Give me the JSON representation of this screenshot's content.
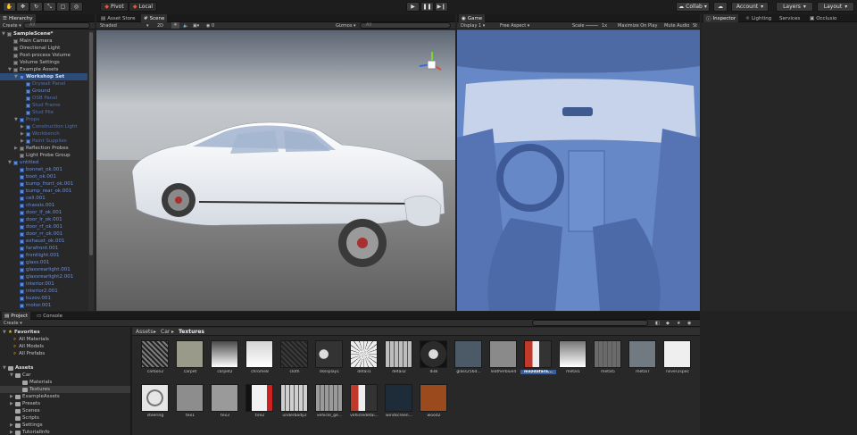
{
  "toolbar": {
    "pivot": "Pivot",
    "local": "Local",
    "collab": "Collab",
    "account": "Account",
    "layers": "Layers",
    "layout": "Layout"
  },
  "hierarchy": {
    "tab": "Hierarchy",
    "create": "Create",
    "search_placeholder": "All",
    "items": [
      {
        "label": "SampleScene*",
        "indent": 0,
        "style": "scene",
        "arrow": "▼"
      },
      {
        "label": "Main Camera",
        "indent": 1,
        "style": "normal"
      },
      {
        "label": "Directional Light",
        "indent": 1,
        "style": "normal"
      },
      {
        "label": "Post-process Volume",
        "indent": 1,
        "style": "normal"
      },
      {
        "label": "Volume Settings",
        "indent": 1,
        "style": "normal"
      },
      {
        "label": "Example Assets",
        "indent": 1,
        "style": "normal",
        "arrow": "▼"
      },
      {
        "label": "Workshop Set",
        "indent": 2,
        "style": "selected",
        "arrow": "▼"
      },
      {
        "label": "Drywall Panel",
        "indent": 3,
        "style": "dim"
      },
      {
        "label": "Ground",
        "indent": 3,
        "style": "blue"
      },
      {
        "label": "OSB Panel",
        "indent": 3,
        "style": "dim"
      },
      {
        "label": "Stud Frame",
        "indent": 3,
        "style": "dim"
      },
      {
        "label": "Stud Pile",
        "indent": 3,
        "style": "dim"
      },
      {
        "label": "Props",
        "indent": 2,
        "style": "dim",
        "arrow": "▼"
      },
      {
        "label": "Construction Light",
        "indent": 3,
        "style": "dim",
        "arrow": "▶"
      },
      {
        "label": "Workbench",
        "indent": 3,
        "style": "dim",
        "arrow": "▶"
      },
      {
        "label": "Paint Supplies",
        "indent": 3,
        "style": "dim",
        "arrow": "▶"
      },
      {
        "label": "Reflection Probes",
        "indent": 2,
        "style": "normal",
        "arrow": "▶"
      },
      {
        "label": "Light Probe Group",
        "indent": 2,
        "style": "normal"
      },
      {
        "label": "untitled",
        "indent": 1,
        "style": "blue",
        "arrow": "▼"
      },
      {
        "label": "bonnet_ok.001",
        "indent": 2,
        "style": "blue"
      },
      {
        "label": "boot_ok.001",
        "indent": 2,
        "style": "blue"
      },
      {
        "label": "bump_front_ok.001",
        "indent": 2,
        "style": "blue"
      },
      {
        "label": "bump_rear_ok.001",
        "indent": 2,
        "style": "blue"
      },
      {
        "label": "cell.001",
        "indent": 2,
        "style": "blue"
      },
      {
        "label": "chassis.001",
        "indent": 2,
        "style": "blue"
      },
      {
        "label": "door_lf_ok.001",
        "indent": 2,
        "style": "blue"
      },
      {
        "label": "door_lr_ok.001",
        "indent": 2,
        "style": "blue"
      },
      {
        "label": "door_rf_ok.001",
        "indent": 2,
        "style": "blue"
      },
      {
        "label": "door_rr_ok.001",
        "indent": 2,
        "style": "blue"
      },
      {
        "label": "exhaust_ok.001",
        "indent": 2,
        "style": "blue"
      },
      {
        "label": "farafront.001",
        "indent": 2,
        "style": "blue"
      },
      {
        "label": "frontlight.001",
        "indent": 2,
        "style": "blue"
      },
      {
        "label": "glass.001",
        "indent": 2,
        "style": "blue"
      },
      {
        "label": "glassrearlight.001",
        "indent": 2,
        "style": "blue"
      },
      {
        "label": "glassrearlight2.001",
        "indent": 2,
        "style": "blue"
      },
      {
        "label": "interior.001",
        "indent": 2,
        "style": "blue"
      },
      {
        "label": "interior2.001",
        "indent": 2,
        "style": "blue"
      },
      {
        "label": "kuzov.001",
        "indent": 2,
        "style": "blue"
      },
      {
        "label": "motor.001",
        "indent": 2,
        "style": "blue"
      }
    ]
  },
  "scene": {
    "tab_asset_store": "Asset Store",
    "tab_scene": "Scene",
    "shading": "Shaded",
    "mode_2d": "2D",
    "gizmos": "Gizmos",
    "search_placeholder": "All"
  },
  "game": {
    "tab": "Game",
    "display": "Display 1",
    "aspect": "Free Aspect",
    "scale_label": "Scale",
    "scale_value": "1x",
    "maximize": "Maximize On Play",
    "mute": "Mute Audio",
    "stats": "St"
  },
  "inspector": {
    "tab": "Inspector",
    "lighting": "Lighting",
    "services": "Services",
    "occlusion": "Occlusio"
  },
  "project": {
    "tab_project": "Project",
    "tab_console": "Console",
    "create": "Create",
    "favorites_label": "Favorites",
    "favorites": [
      "All Materials",
      "All Models",
      "All Prefabs"
    ],
    "assets_label": "Assets",
    "tree": [
      {
        "label": "Car",
        "indent": 1,
        "arrow": "▼"
      },
      {
        "label": "Materials",
        "indent": 2
      },
      {
        "label": "Textures",
        "indent": 2,
        "selected": true
      },
      {
        "label": "ExampleAssets",
        "indent": 1,
        "arrow": "▶"
      },
      {
        "label": "Presets",
        "indent": 1,
        "arrow": "▶"
      },
      {
        "label": "Scenes",
        "indent": 1
      },
      {
        "label": "Scripts",
        "indent": 1
      },
      {
        "label": "Settings",
        "indent": 1,
        "arrow": "▶"
      },
      {
        "label": "TutorialInfo",
        "indent": 1,
        "arrow": "▶"
      }
    ],
    "breadcrumb": [
      "Assets",
      "Car",
      "Textures"
    ],
    "textures": [
      {
        "label": "carbon2",
        "color": "#7c7c7c",
        "kind": "dots"
      },
      {
        "label": "carpet",
        "color": "#9a9a8a",
        "kind": "flat"
      },
      {
        "label": "carpet2",
        "color": "#4a4a4a",
        "kind": "grad"
      },
      {
        "label": "chrome8",
        "color": "#d4d4d4",
        "kind": "grad"
      },
      {
        "label": "cloth",
        "color": "#3a3a3a",
        "kind": "dots"
      },
      {
        "label": "dsssplay1",
        "color": "#6a6a6a",
        "kind": "gauges"
      },
      {
        "label": "detail1",
        "color": "#ededed",
        "kind": "spider"
      },
      {
        "label": "detail2",
        "color": "#bdbdbd",
        "kind": "cross"
      },
      {
        "label": "disk",
        "color": "#2b2b2b",
        "kind": "disk"
      },
      {
        "label": "glass256d...",
        "color": "#4b5a66",
        "kind": "flat"
      },
      {
        "label": "leatherblue4",
        "color": "#8a8a8a",
        "kind": "flat"
      },
      {
        "label": "mazdafara...",
        "color": "#a23a3a",
        "kind": "lights",
        "selected": true
      },
      {
        "label": "metal1",
        "color": "#777777",
        "kind": "grad"
      },
      {
        "label": "metal5",
        "color": "#6a6a6a",
        "kind": "cross"
      },
      {
        "label": "metal7",
        "color": "#707a80",
        "kind": "flat"
      },
      {
        "label": "nilver2spec",
        "color": "#efefef",
        "kind": "flat"
      },
      {
        "label": "steering",
        "color": "#e6e6e6",
        "kind": "wheel"
      },
      {
        "label": "tex1",
        "color": "#8d8d8d",
        "kind": "flat"
      },
      {
        "label": "tex3",
        "color": "#9a9a9a",
        "kind": "flat"
      },
      {
        "label": "tire2",
        "color": "#f2f2f2",
        "kind": "tire"
      },
      {
        "label": "underbody2",
        "color": "#cfcfcf",
        "kind": "cross"
      },
      {
        "label": "vehicle_ge...",
        "color": "#9a9a9a",
        "kind": "cross"
      },
      {
        "label": "vehicledetai...",
        "color": "#3d3d3d",
        "kind": "lights"
      },
      {
        "label": "windscreen...",
        "color": "#1e2c3a",
        "kind": "flat"
      },
      {
        "label": "wood2",
        "color": "#9a4a1c",
        "kind": "flat"
      }
    ]
  }
}
